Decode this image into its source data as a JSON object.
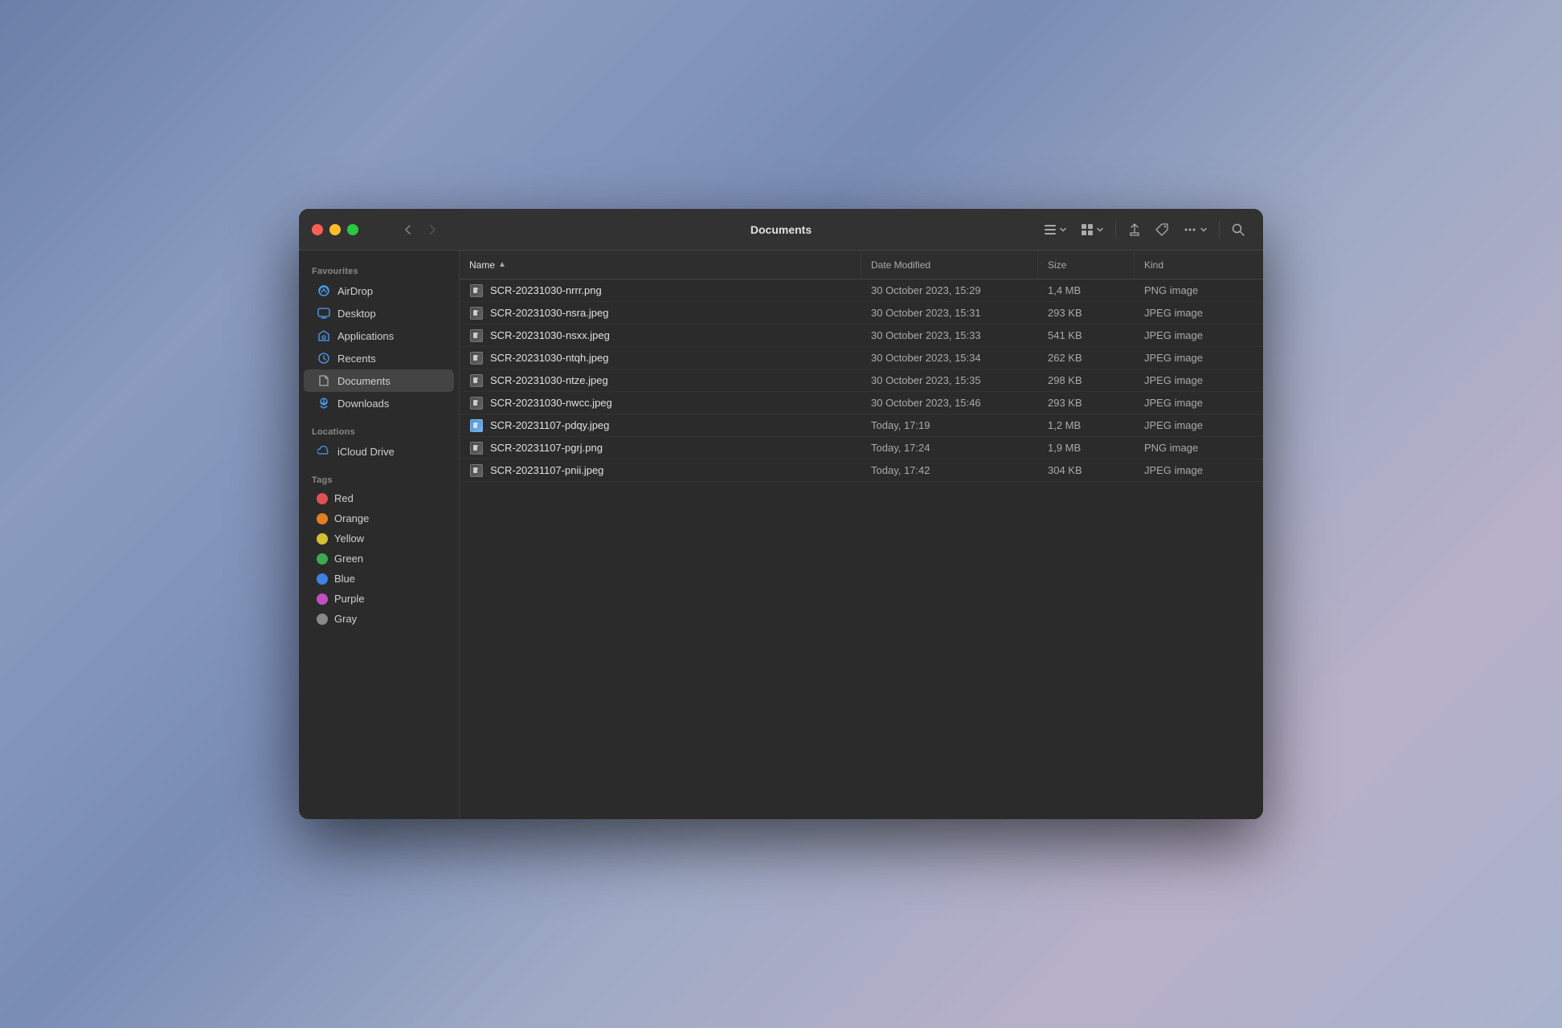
{
  "window": {
    "title": "Documents"
  },
  "toolbar": {
    "back_label": "‹",
    "forward_label": "›",
    "list_view_label": "≡",
    "grid_view_label": "⊞",
    "share_label": "↑",
    "tag_label": "◇",
    "more_label": "···",
    "search_label": "⌕"
  },
  "sidebar": {
    "favourites_label": "Favourites",
    "locations_label": "Locations",
    "tags_label": "Tags",
    "items": [
      {
        "id": "airdrop",
        "label": "AirDrop",
        "icon": "airdrop"
      },
      {
        "id": "desktop",
        "label": "Desktop",
        "icon": "desktop"
      },
      {
        "id": "applications",
        "label": "Applications",
        "icon": "applications"
      },
      {
        "id": "recents",
        "label": "Recents",
        "icon": "recents"
      },
      {
        "id": "documents",
        "label": "Documents",
        "icon": "documents",
        "active": true
      },
      {
        "id": "downloads",
        "label": "Downloads",
        "icon": "downloads"
      }
    ],
    "locations": [
      {
        "id": "icloud",
        "label": "iCloud Drive",
        "icon": "icloud"
      }
    ],
    "tags": [
      {
        "id": "red",
        "label": "Red",
        "color": "#e05252"
      },
      {
        "id": "orange",
        "label": "Orange",
        "color": "#e08020"
      },
      {
        "id": "yellow",
        "label": "Yellow",
        "color": "#d4c030"
      },
      {
        "id": "green",
        "label": "Green",
        "color": "#3caa50"
      },
      {
        "id": "blue",
        "label": "Blue",
        "color": "#4080e0"
      },
      {
        "id": "purple",
        "label": "Purple",
        "color": "#c050c0"
      },
      {
        "id": "gray",
        "label": "Gray",
        "color": "#888888"
      }
    ]
  },
  "columns": {
    "name": "Name",
    "date_modified": "Date Modified",
    "size": "Size",
    "kind": "Kind"
  },
  "files": [
    {
      "id": 1,
      "name": "SCR-20231030-nrrr.png",
      "date": "30 October 2023, 15:29",
      "size": "1,4 MB",
      "kind": "PNG image",
      "preview": false
    },
    {
      "id": 2,
      "name": "SCR-20231030-nsra.jpeg",
      "date": "30 October 2023, 15:31",
      "size": "293 KB",
      "kind": "JPEG image",
      "preview": false
    },
    {
      "id": 3,
      "name": "SCR-20231030-nsxx.jpeg",
      "date": "30 October 2023, 15:33",
      "size": "541 KB",
      "kind": "JPEG image",
      "preview": false
    },
    {
      "id": 4,
      "name": "SCR-20231030-ntqh.jpeg",
      "date": "30 October 2023, 15:34",
      "size": "262 KB",
      "kind": "JPEG image",
      "preview": false
    },
    {
      "id": 5,
      "name": "SCR-20231030-ntze.jpeg",
      "date": "30 October 2023, 15:35",
      "size": "298 KB",
      "kind": "JPEG image",
      "preview": false
    },
    {
      "id": 6,
      "name": "SCR-20231030-nwcc.jpeg",
      "date": "30 October 2023, 15:46",
      "size": "293 KB",
      "kind": "JPEG image",
      "preview": false
    },
    {
      "id": 7,
      "name": "SCR-20231107-pdqy.jpeg",
      "date": "Today, 17:19",
      "size": "1,2 MB",
      "kind": "JPEG image",
      "preview": true
    },
    {
      "id": 8,
      "name": "SCR-20231107-pgrj.png",
      "date": "Today, 17:24",
      "size": "1,9 MB",
      "kind": "PNG image",
      "preview": false
    },
    {
      "id": 9,
      "name": "SCR-20231107-pnii.jpeg",
      "date": "Today, 17:42",
      "size": "304 KB",
      "kind": "JPEG image",
      "preview": false
    }
  ]
}
